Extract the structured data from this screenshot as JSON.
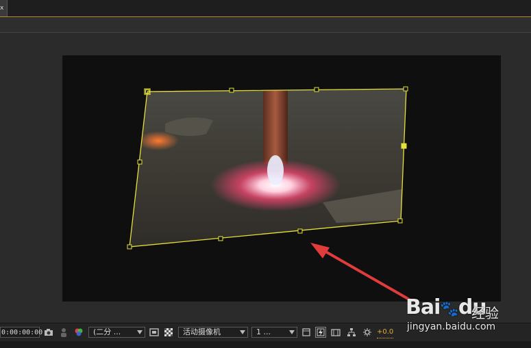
{
  "tabbar": {
    "tab_label": "x"
  },
  "statusbar": {
    "timecode": "0:00:00:00",
    "resolution_label": "(二分 ...",
    "camera_label": "活动摄像机",
    "views_label": "1 ...",
    "exposure_value": "+0.0"
  },
  "watermark": {
    "brand": "Bai",
    "brand2": "du",
    "jingyan": "经验",
    "url": "jingyan.baidu.com"
  },
  "icons": {
    "snapshot": "camera-icon",
    "show_snapshot": "person-icon",
    "channels": "color-channels-icon",
    "region": "region-of-interest-icon",
    "transparency": "transparency-grid-icon",
    "toggle_views": "toggle-views-icon",
    "fast_preview": "fast-preview-icon",
    "timeline": "timeline-icon",
    "flowchart": "flowchart-icon",
    "reset_exposure": "exposure-icon"
  },
  "colors": {
    "accent": "#e1b13a",
    "layer_outline": "#e6e23a",
    "arrow": "#e03c3c"
  }
}
